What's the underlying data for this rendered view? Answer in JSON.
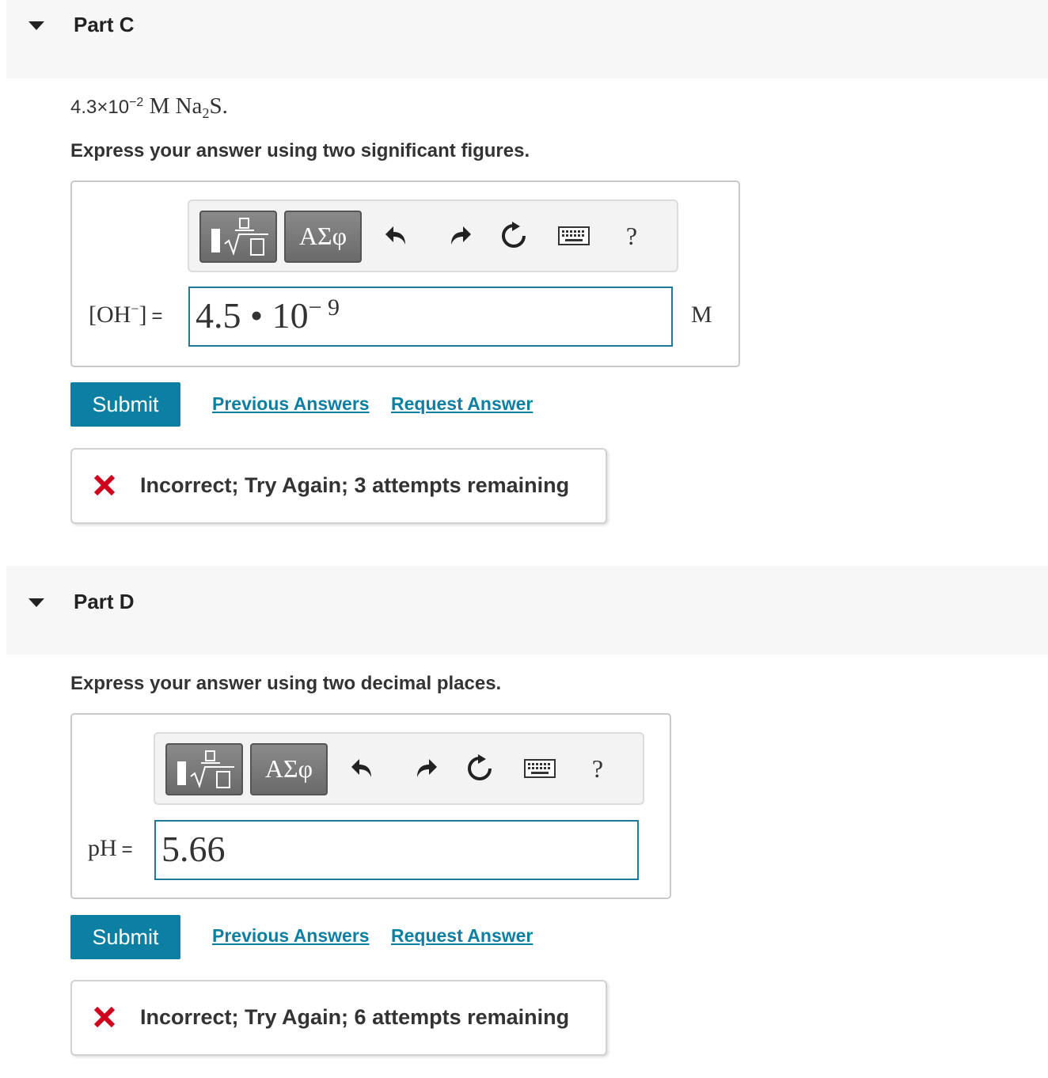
{
  "icons": {
    "collapse": "triangle-down-icon",
    "templates": "fraction-root-icon",
    "greek": "greek-letters",
    "undo": "undo-icon",
    "redo": "redo-icon",
    "reset": "reset-icon",
    "keyboard": "keyboard-icon",
    "help": "question-icon",
    "incorrect": "red-x-icon"
  },
  "colors": {
    "accent": "#0d7fa3",
    "error": "#d0021b",
    "header_bg": "#f7f7f7"
  },
  "part_c": {
    "title": "Part C",
    "question": {
      "coefficient": "4.3×10",
      "exponent": "−2",
      "unit_pre": " M Na",
      "sub": "2",
      "unit_post": "S."
    },
    "prompt": "Express your answer using two significant figures.",
    "toolbar": {
      "greek_label": "ΑΣφ",
      "help_label": "?"
    },
    "input_label": "[OH",
    "input_label_sup": "−",
    "input_label_close": "]",
    "equals": "=",
    "answer": {
      "mantissa": "4.5 • 10",
      "exponent": "− 9"
    },
    "unit": "M",
    "submit_label": "Submit",
    "previous_answers": "Previous Answers",
    "request_answer": "Request Answer",
    "feedback": "Incorrect; Try Again; 3 attempts remaining"
  },
  "part_d": {
    "title": "Part D",
    "prompt": "Express your answer using two decimal places.",
    "toolbar": {
      "greek_label": "ΑΣφ",
      "help_label": "?"
    },
    "input_label": "pH",
    "equals": "=",
    "answer": "5.66",
    "submit_label": "Submit",
    "previous_answers": "Previous Answers",
    "request_answer": "Request Answer",
    "feedback": "Incorrect; Try Again; 6 attempts remaining"
  }
}
